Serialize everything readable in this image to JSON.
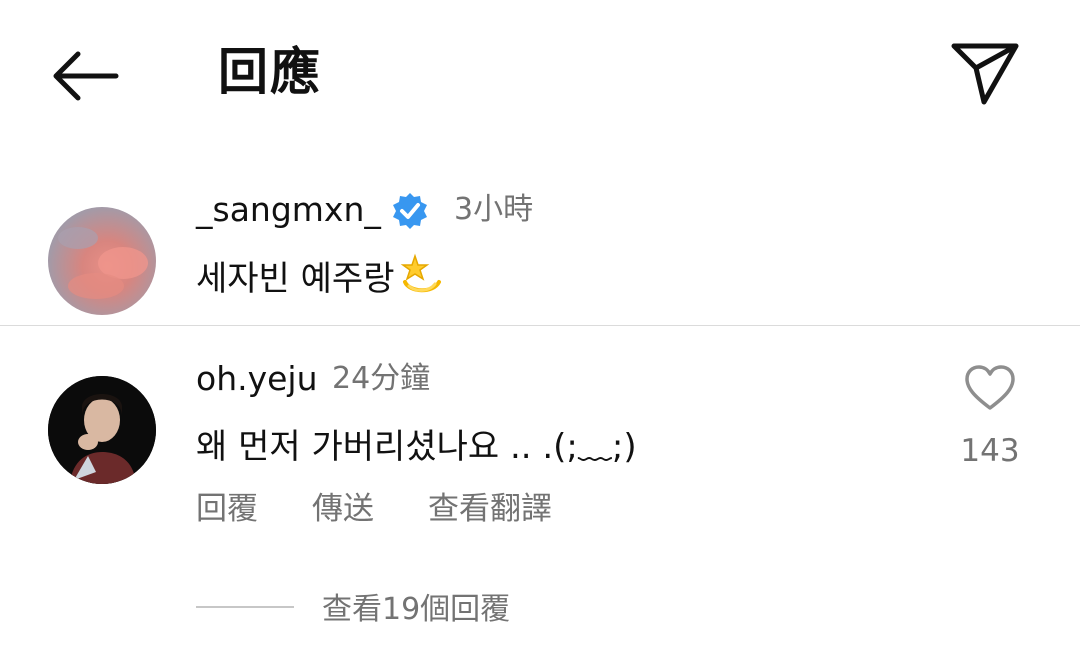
{
  "header": {
    "title": "回應",
    "back_icon": "arrow-left-icon",
    "send_icon": "paper-plane-icon"
  },
  "caption": {
    "username": "_sangmxn_",
    "verified_icon": "verified-badge-icon",
    "badge_color": "#3897f0",
    "time": "3小時",
    "text": "세자빈 예주랑",
    "emoji_icon": "dizzy-star-emoji-icon"
  },
  "comment": {
    "username": "oh.yeju",
    "time": "24分鐘",
    "text": "왜 먼저 가버리셨나요 .. .(;﹏;)",
    "actions": {
      "reply": "回覆",
      "share": "傳送",
      "translate": "查看翻譯"
    },
    "like_icon": "heart-outline-icon",
    "likes": "143"
  },
  "replies": {
    "label": "查看19個回覆"
  },
  "colors": {
    "secondary_text": "#737373",
    "divider": "#dbdbdb"
  }
}
